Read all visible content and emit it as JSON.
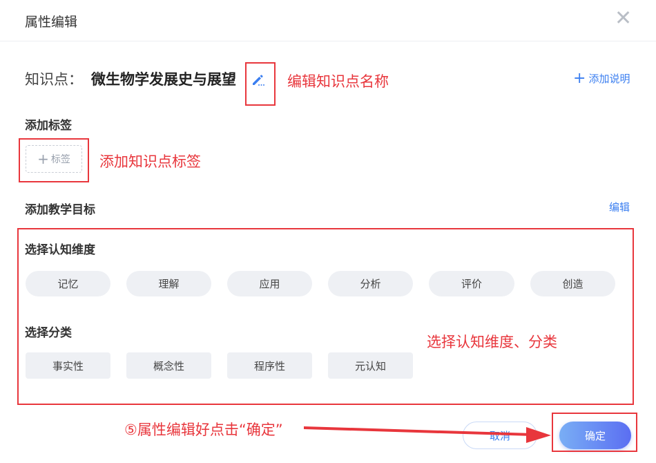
{
  "dialog": {
    "title": "属性编辑",
    "close_icon": "close-icon"
  },
  "knowledge_point": {
    "label": "知识点：",
    "name": "微生物学发展史与展望",
    "edit_icon": "pencil-icon"
  },
  "add_description": {
    "plus": "+",
    "label": "添加说明"
  },
  "tags": {
    "section_label": "添加标签",
    "add_button_plus": "+",
    "add_button_label": "标签"
  },
  "objectives": {
    "section_label": "添加教学目标",
    "edit_label": "编辑",
    "cognitive": {
      "label": "选择认知维度",
      "options": [
        "记忆",
        "理解",
        "应用",
        "分析",
        "评价",
        "创造"
      ]
    },
    "category": {
      "label": "选择分类",
      "options": [
        "事实性",
        "概念性",
        "程序性",
        "元认知"
      ]
    }
  },
  "footer": {
    "cancel_label": "取消",
    "confirm_label": "确定"
  },
  "annotations": {
    "edit_name": "编辑知识点名称",
    "add_tag": "添加知识点标签",
    "select_dims": "选择认知维度、分类",
    "confirm_step": "⑤属性编辑好点击“确定”"
  },
  "colors": {
    "accent_blue": "#3a7ef0",
    "annotation_red": "#e8363c",
    "pill_bg": "#eef0f4"
  }
}
